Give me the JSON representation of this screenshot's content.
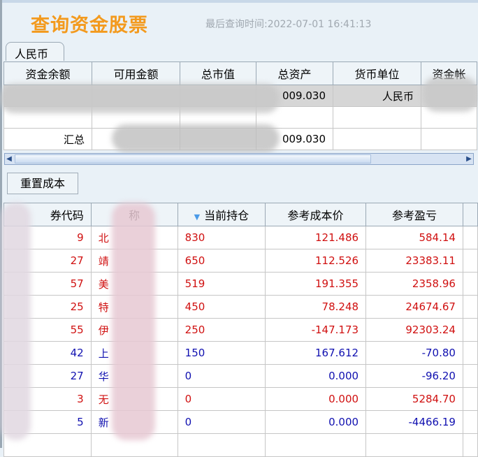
{
  "title": "查询资金股票",
  "query_time": "最后查询时间:2022-07-01 16:41:13",
  "tab": "人民币",
  "fund_table": {
    "headers": [
      "资金余额",
      "可用金额",
      "总市值",
      "总资产",
      "货币单位",
      "资金帐"
    ],
    "rows": [
      [
        "",
        "",
        "",
        "009.030",
        "人民币",
        ""
      ],
      [
        "",
        "",
        "",
        "",
        "",
        ""
      ],
      [
        "汇总",
        "",
        "",
        "009.030",
        "",
        ""
      ]
    ]
  },
  "reset_button": "重置成本",
  "pos_table": {
    "headers": [
      "券代码",
      "称",
      "当前持仓",
      "参考成本价",
      "参考盈亏"
    ],
    "rows": [
      {
        "code": "9",
        "name": "北",
        "qty": "830",
        "cost": "121.486",
        "pl": "584.14",
        "color": "red"
      },
      {
        "code": "27",
        "name": "靖",
        "qty": "650",
        "cost": "112.526",
        "pl": "23383.11",
        "color": "red"
      },
      {
        "code": "57",
        "name": "美",
        "qty": "519",
        "cost": "191.355",
        "pl": "2358.96",
        "color": "red"
      },
      {
        "code": "25",
        "name": "特",
        "qty": "450",
        "cost": "78.248",
        "pl": "24674.67",
        "color": "red"
      },
      {
        "code": "55",
        "name": "伊",
        "qty": "250",
        "cost": "-147.173",
        "pl": "92303.24",
        "color": "red"
      },
      {
        "code": "42",
        "name": "上",
        "qty": "150",
        "cost": "167.612",
        "pl": "-70.80",
        "color": "blue"
      },
      {
        "code": "27",
        "name": "华",
        "qty": "0",
        "cost": "0.000",
        "pl": "-96.20",
        "color": "blue"
      },
      {
        "code": "3",
        "name": "无",
        "qty": "0",
        "cost": "0.000",
        "pl": "5284.70",
        "color": "red"
      },
      {
        "code": "5",
        "name": "新",
        "qty": "0",
        "cost": "0.000",
        "pl": "-4466.19",
        "color": "blue"
      }
    ]
  }
}
